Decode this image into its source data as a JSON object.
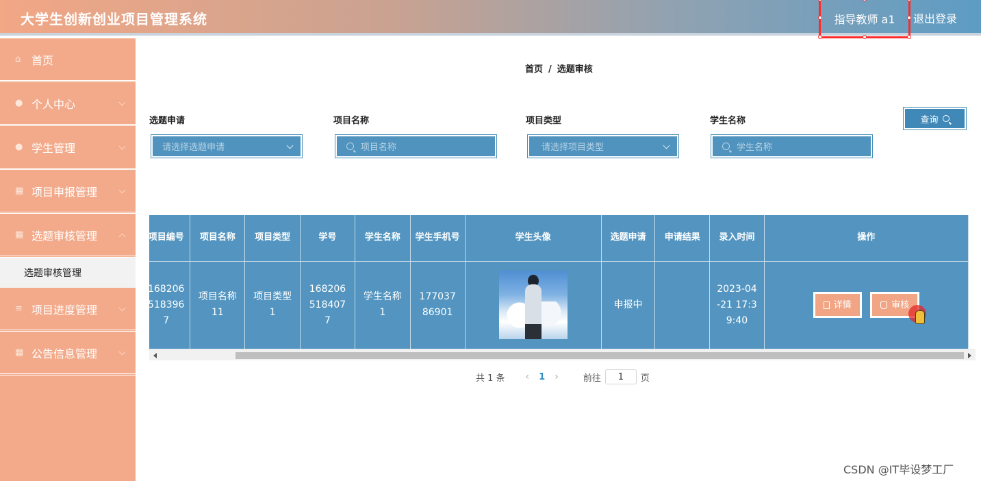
{
  "header": {
    "title": "大学生创新创业项目管理系统",
    "user": "指导教师 a1",
    "logout": "退出登录"
  },
  "sidebar": {
    "items": [
      {
        "label": "首页",
        "icon": "home-icon"
      },
      {
        "label": "个人中心",
        "icon": "user-icon"
      },
      {
        "label": "学生管理",
        "icon": "user-icon"
      },
      {
        "label": "项目申报管理",
        "icon": "grid-icon"
      },
      {
        "label": "选题审核管理",
        "icon": "grid-icon"
      }
    ],
    "active_sub": "选题审核管理",
    "items_after": [
      {
        "label": "项目进度管理",
        "icon": "list-icon"
      },
      {
        "label": "公告信息管理",
        "icon": "grid-icon"
      }
    ]
  },
  "breadcrumb": {
    "home": "首页",
    "sep": "/",
    "current": "选题审核"
  },
  "filters": {
    "apply": {
      "label": "选题申请",
      "placeholder": "请选择选题申请"
    },
    "project_name": {
      "label": "项目名称",
      "placeholder": "项目名称"
    },
    "project_type": {
      "label": "项目类型",
      "placeholder": "请选择项目类型"
    },
    "student_name": {
      "label": "学生名称",
      "placeholder": "学生名称"
    },
    "query_label": "查询"
  },
  "table": {
    "headers": [
      "项目编号",
      "项目名称",
      "项目类型",
      "学号",
      "学生名称",
      "学生手机号",
      "学生头像",
      "选题申请",
      "申请结果",
      "录入时间",
      "操作"
    ],
    "rows": [
      {
        "project_no": "1682065183967",
        "project_name": "项目名称11",
        "project_type": "项目类型1",
        "student_no": "1682065184077",
        "student_name": "学生名称1",
        "phone": "17703786901",
        "apply": "申报中",
        "result": "",
        "time": "2023-04-21 17:39:40",
        "detail_label": "详情",
        "review_label": "审核"
      }
    ]
  },
  "pagination": {
    "total": "共 1 条",
    "prev": "‹",
    "current": "1",
    "next": "›",
    "goto_label": "前往",
    "goto_value": "1",
    "page_suffix": "页"
  },
  "watermark": "CSDN @IT毕设梦工厂",
  "colors": {
    "accent_peach": "#f3aa8a",
    "accent_blue": "#5395c0",
    "highlight": "#ff2a2a"
  }
}
